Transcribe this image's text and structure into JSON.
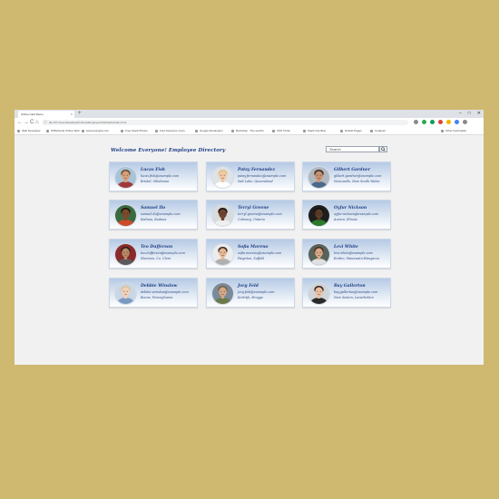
{
  "browser": {
    "tab_title": "Online Card Demo",
    "tab_close": "×",
    "new_tab": "+",
    "win_min": "–",
    "win_max": "□",
    "win_close": "✕",
    "back": "←",
    "forward": "→",
    "reload": "C",
    "home": "⌂",
    "url": "file:///C:/Users/Desktop/html/css/Employee%20Cards/index.html",
    "bookmarks": [
      "Web Developer",
      "W3Schools Online Web",
      "www.example.com",
      "Free Stock Photos",
      "Font Awesome Icons",
      "Google Developers",
      "Bootstrap · The world's",
      "CSS Tricks",
      "Stack Overflow",
      "GitHub Pages",
      "Codepen",
      "Other bookmarks"
    ],
    "extension_colors": [
      "#8a8a8a",
      "#2fa84f",
      "#0f9d58",
      "#db4437",
      "#f4b400",
      "#4285f4",
      "#8a8a8a"
    ]
  },
  "page": {
    "title": "Welcome Everyone! Employee Directory",
    "search": {
      "placeholder": "Search"
    }
  },
  "employees": [
    {
      "name": "Lucas Fish",
      "email": "lucas.fish@example.com",
      "city": "Bristol, Oklahoma",
      "skin": "#d6a07a",
      "hair": "#6d4a2b",
      "shirt": "#a03a3a",
      "bg": "#a9c3d6"
    },
    {
      "name": "Patsy Fernandez",
      "email": "patsy.fernandez@example.com",
      "city": "Salt Lake, Queensland",
      "skin": "#f0c9a8",
      "hair": "#e0c28a",
      "shirt": "#ffffff",
      "bg": "#dfe3e6"
    },
    {
      "name": "Gilbert Gardner",
      "email": "gilbert.gardner@example.com",
      "city": "Newcastle, New South Wales",
      "skin": "#c89272",
      "hair": "#3a2a20",
      "shirt": "#4a6a8a",
      "bg": "#b0b7be"
    },
    {
      "name": "Samuel Ilo",
      "email": "samuel.ilo@example.com",
      "city": "Kaduna, Kaduna",
      "skin": "#7a4a2b",
      "hair": "#1e140f",
      "shirt": "#d04a2a",
      "bg": "#3a6a40"
    },
    {
      "name": "Terryl Greene",
      "email": "terryl.greene@example.com",
      "city": "Cobourg, Ontario",
      "skin": "#6e4430",
      "hair": "#1a1412",
      "shirt": "#eeeeee",
      "bg": "#d8dadc"
    },
    {
      "name": "Oyfur Nickson",
      "email": "oyfur.nickson@example.com",
      "city": "Aurora, Illinois",
      "skin": "#5a3a26",
      "hair": "#111111",
      "shirt": "#2a7a2a",
      "bg": "#1e1e1e"
    },
    {
      "name": "Teo Dufferson",
      "email": "teo.dufferson@example.com",
      "city": "Shannon, Co. Clare",
      "skin": "#b88a66",
      "hair": "#2a2018",
      "shirt": "#5a5a5a",
      "bg": "#8a2a2a"
    },
    {
      "name": "Sofia Moreno",
      "email": "sofia.moreno@example.com",
      "city": "Paignton, Suffolk",
      "skin": "#e4b896",
      "hair": "#3a2a22",
      "shirt": "#b0b0b0",
      "bg": "#ececec"
    },
    {
      "name": "Levi White",
      "email": "levi.white@example.com",
      "city": "Embro, Manawatu-Wanganui",
      "skin": "#d8a888",
      "hair": "#4a2e20",
      "shirt": "#e0e0e0",
      "bg": "#58635a"
    },
    {
      "name": "Debbie Winslow",
      "email": "debbie.winslow@example.com",
      "city": "Boone, Pennsylvania",
      "skin": "#f2d2b6",
      "hair": "#d8c2a0",
      "shirt": "#7a9ac2",
      "bg": "#c9d6e3"
    },
    {
      "name": "Jorg Feld",
      "email": "jorg.feld@example.com",
      "city": "Kortrijk, Brugge",
      "skin": "#d6a886",
      "hair": "#7a6044",
      "shirt": "#6a7a4a",
      "bg": "#7a8a9a"
    },
    {
      "name": "Bay Gallerton",
      "email": "bay.gallerton@example.com",
      "city": "New Seaton, Lanarkshire",
      "skin": "#eac0a2",
      "hair": "#3a241a",
      "shirt": "#2a2a2a",
      "bg": "#cfd4d8"
    }
  ]
}
